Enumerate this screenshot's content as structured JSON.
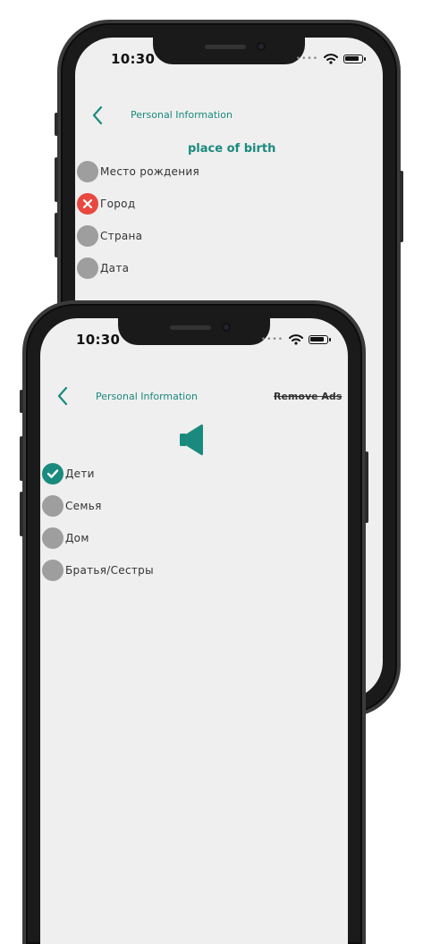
{
  "colors": {
    "accent": "#1a8a7e",
    "wrong": "#e8483f",
    "neutral": "#9e9e9e",
    "screen_bg": "#efefef"
  },
  "back_screen": {
    "status": {
      "time": "10:30"
    },
    "header": {
      "title": "Personal Information",
      "back_icon": "chevron-left-icon"
    },
    "section_title": "place of birth",
    "items": [
      {
        "label": "Место рождения",
        "state": "neutral"
      },
      {
        "label": "Город",
        "state": "wrong"
      },
      {
        "label": "Страна",
        "state": "neutral"
      },
      {
        "label": "Дата",
        "state": "neutral"
      }
    ]
  },
  "front_screen": {
    "status": {
      "time": "10:30"
    },
    "header": {
      "title": "Personal Information",
      "remove_ads": "Remove Ads",
      "back_icon": "chevron-left-icon"
    },
    "audio_icon": "speaker-icon",
    "items": [
      {
        "label": "Дети",
        "state": "correct"
      },
      {
        "label": "Семья",
        "state": "neutral"
      },
      {
        "label": "Дом",
        "state": "neutral"
      },
      {
        "label": "Братья/Сестры",
        "state": "neutral"
      }
    ]
  }
}
